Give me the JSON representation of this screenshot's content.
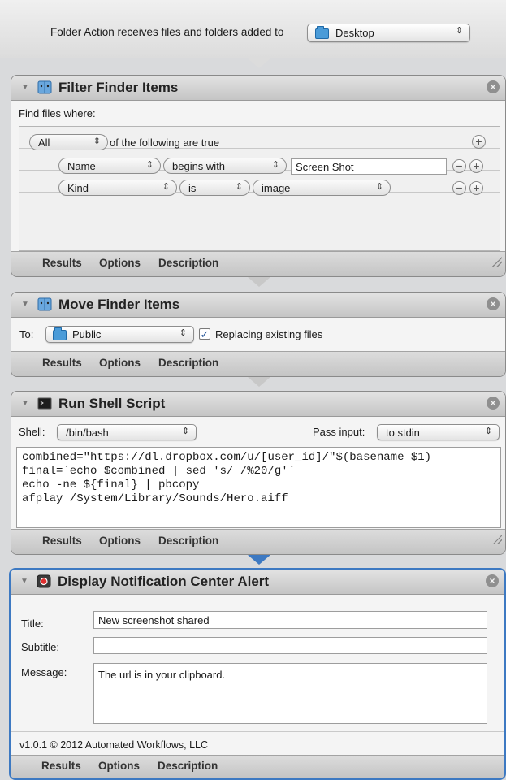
{
  "header": {
    "text": "Folder Action receives files and folders added to",
    "folder": "Desktop",
    "folder_icon": "folder-icon"
  },
  "filter": {
    "title": "Filter Finder Items",
    "find_label": "Find files where:",
    "quantifier": "All",
    "following": "of the following are true",
    "rows": [
      {
        "field": "Name",
        "op": "begins with",
        "value": "Screen Shot"
      },
      {
        "field": "Kind",
        "op": "is",
        "value": "image"
      }
    ]
  },
  "move": {
    "title": "Move Finder Items",
    "to_label": "To:",
    "folder": "Public",
    "replacing": "Replacing existing files",
    "replacing_checked": true
  },
  "shell": {
    "title": "Run Shell Script",
    "shell_label": "Shell:",
    "shell": "/bin/bash",
    "pass_label": "Pass input:",
    "pass": "to stdin",
    "lines": [
      "combined=\"https://dl.dropbox.com/u/[user_id]/\"$(basename $1)",
      "final=`echo $combined | sed 's/ /%20/g'`",
      "echo -ne ${final} | pbcopy",
      "afplay /System/Library/Sounds/Hero.aiff"
    ]
  },
  "notify": {
    "title": "Display Notification Center Alert",
    "title_label": "Title:",
    "title_value": "New screenshot shared",
    "subtitle_label": "Subtitle:",
    "subtitle_value": "",
    "message_label": "Message:",
    "message_value": "The url is in your clipboard.",
    "version": "v1.0.1 © 2012 Automated Workflows, LLC"
  },
  "footer_tabs": {
    "results": "Results",
    "options": "Options",
    "description": "Description"
  },
  "colors": {
    "selection_border": "#3d79c2",
    "folder": "#4a9bd8"
  }
}
